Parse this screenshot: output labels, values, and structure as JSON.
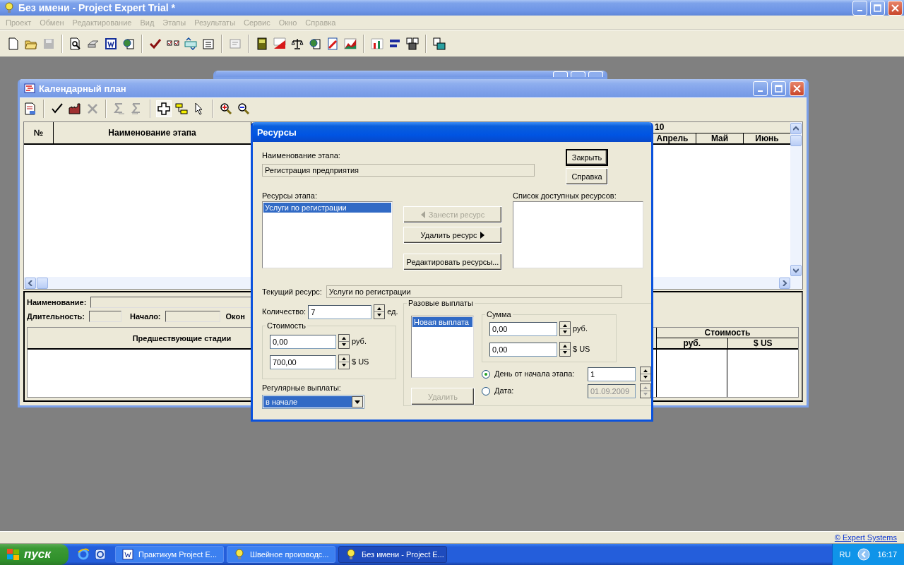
{
  "app": {
    "title": "Без имени - Project Expert Trial *"
  },
  "menu": [
    {
      "label": "Проект",
      "disabled": true
    },
    {
      "label": "Обмен",
      "disabled": true
    },
    {
      "label": "Редактирование",
      "disabled": true
    },
    {
      "label": "Вид",
      "disabled": true
    },
    {
      "label": "Этапы",
      "disabled": true
    },
    {
      "label": "Результаты",
      "disabled": true
    },
    {
      "label": "Сервис",
      "disabled": true
    },
    {
      "label": "Окно",
      "disabled": true
    },
    {
      "label": "Справка",
      "disabled": true
    }
  ],
  "calendar_window": {
    "title": "Календарный план",
    "grid": {
      "columns": [
        "№",
        "Наименование этапа"
      ],
      "year": "10",
      "months": [
        "Апрель",
        "Май",
        "Июнь"
      ]
    },
    "details": {
      "name_label": "Наименование:",
      "duration_label": "Длительность:",
      "start_label": "Начало:",
      "end_label": "Окон",
      "table": {
        "column_1": "Предшествующие стадии",
        "cost": "Стоимость",
        "cost_columns": [
          "руб.",
          "$ US"
        ]
      }
    }
  },
  "dialog": {
    "title": "Ресурсы",
    "stage_label": "Наименование этапа:",
    "stage_value": "Регистрация предприятия",
    "buttons": [
      {
        "label": "Закрыть",
        "default": true
      },
      {
        "label": "Справка",
        "default": false
      }
    ],
    "stage_resources": {
      "label": "Ресурсы этапа:",
      "items": [
        {
          "label": "Услуги по регистрации",
          "selected": true
        }
      ]
    },
    "actions": [
      {
        "label": "Занести ресурс",
        "disabled": true,
        "kind": "back"
      },
      {
        "label": "Удалить ресурс",
        "disabled": false,
        "kind": "forward"
      },
      {
        "label": "Редактировать ресурсы...",
        "disabled": false,
        "kind": "plain"
      }
    ],
    "available": {
      "label": "Список доступных ресурсов:"
    },
    "current_label": "Текущий ресурс:",
    "current_value": "Услуги по регистрации",
    "quantity": {
      "label": "Количество:",
      "value": "7",
      "unit": "ед."
    },
    "cost": {
      "legend": "Стоимость",
      "rows": [
        {
          "value": "0,00",
          "unit": "руб."
        },
        {
          "value": "700,00",
          "unit": "$ US"
        }
      ]
    },
    "regular": {
      "label": "Регулярные выплаты:",
      "value": "в начале"
    },
    "one_time": {
      "legend": "Разовые выплаты",
      "items": [
        {
          "label": "Новая выплата",
          "selected": true
        }
      ],
      "delete_button": {
        "label": "Удалить",
        "disabled": true
      },
      "sum": {
        "legend": "Сумма",
        "rows": [
          {
            "value": "0,00",
            "unit": "руб."
          },
          {
            "value": "0,00",
            "unit": "$ US"
          }
        ]
      },
      "options": [
        {
          "label": "День от начала этапа:",
          "selected": true,
          "value": "1",
          "disabled": false
        },
        {
          "label": "Дата:",
          "selected": false,
          "value": "01.09.2009",
          "disabled": true
        }
      ]
    }
  },
  "status_bar": {
    "link": "© Expert Systems"
  },
  "taskbar": {
    "start": "пуск",
    "tasks": [
      {
        "label": "Практикум Project E...",
        "selected": false,
        "kind": "word"
      },
      {
        "label": "Швейное производс...",
        "selected": false,
        "kind": "bulb"
      },
      {
        "label": "Без имени - Project E...",
        "selected": true,
        "kind": "bulb"
      }
    ],
    "language": "RU",
    "clock": "16:17"
  }
}
